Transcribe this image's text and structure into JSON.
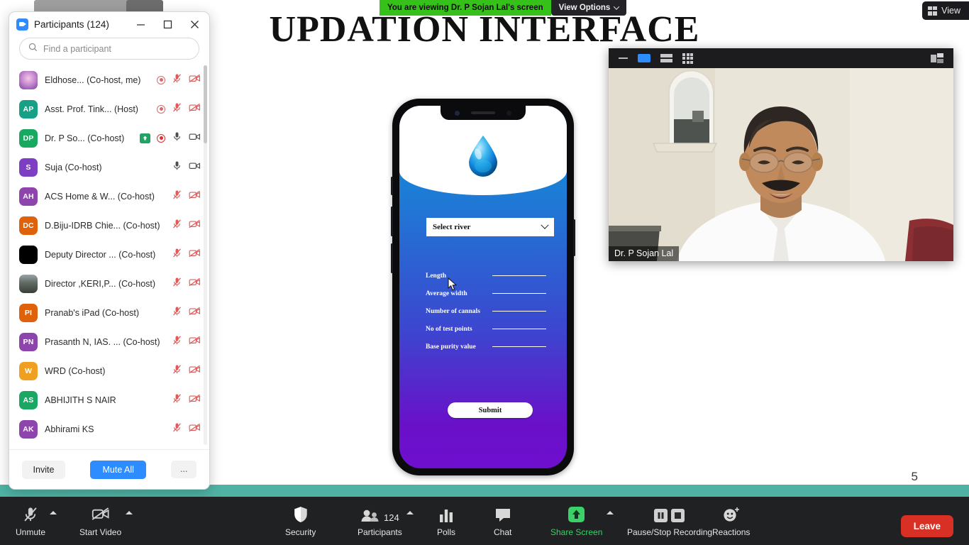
{
  "share_banner": {
    "viewing_text": "You are viewing Dr. P Sojan Lal's screen",
    "view_options_label": "View Options",
    "chevron_icon": "chevron-down-icon",
    "green": "#35c11a"
  },
  "view_pill": {
    "label": "View",
    "icon": "grid-view-icon"
  },
  "slide": {
    "title": "UPDATION INTERFACE",
    "page_number": "5",
    "phone": {
      "dropdown": {
        "label": "Select river",
        "chevron_icon": "chevron-down-icon"
      },
      "droplet_icon": "water-droplet-icon",
      "fields": [
        {
          "label": "Length"
        },
        {
          "label": "Average width"
        },
        {
          "label": "Number of cannals"
        },
        {
          "label": "No of test points"
        },
        {
          "label": "Base purity value"
        }
      ],
      "submit_label": "Submit"
    }
  },
  "participants_panel": {
    "title": "Participants",
    "count_label": "(124)",
    "app_icon": "zoom-logo-icon",
    "window_buttons": {
      "minimize": "minimize-icon",
      "maximize": "maximize-icon",
      "close": "close-icon"
    },
    "search": {
      "placeholder": "Find a participant",
      "icon": "search-icon"
    },
    "rows": [
      {
        "initials": "",
        "avatar": "photo1",
        "color": "#b77ac4",
        "name": "Eldhose... (Co-host, me)",
        "rec": "idle",
        "mic": "mic-muted-icon",
        "cam": "video-off-icon",
        "badge": ""
      },
      {
        "initials": "AP",
        "avatar": "letters",
        "color": "#16a085",
        "name": "Asst. Prof. Tink...  (Host)",
        "rec": "idle",
        "mic": "mic-muted-icon",
        "cam": "video-off-icon",
        "badge": ""
      },
      {
        "initials": "DP",
        "avatar": "letters",
        "color": "#18a860",
        "name": "Dr. P So... (Co-host)",
        "rec": "active",
        "mic": "mic-on-icon",
        "cam": "video-on-icon",
        "badge": "screen-share-icon"
      },
      {
        "initials": "S",
        "avatar": "letters",
        "color": "#7d3ec4",
        "name": "Suja (Co-host)",
        "rec": "none",
        "mic": "mic-on-icon",
        "cam": "video-on-icon",
        "badge": ""
      },
      {
        "initials": "AH",
        "avatar": "letters",
        "color": "#8e44ad",
        "name": "ACS Home & W...  (Co-host)",
        "rec": "none",
        "mic": "mic-muted-icon",
        "cam": "video-off-icon",
        "badge": ""
      },
      {
        "initials": "DC",
        "avatar": "letters",
        "color": "#e0610b",
        "name": "D.Biju-IDRB Chie... (Co-host)",
        "rec": "none",
        "mic": "mic-muted-icon",
        "cam": "video-off-icon",
        "badge": ""
      },
      {
        "initials": "",
        "avatar": "black",
        "color": "#000000",
        "name": "Deputy Director ... (Co-host)",
        "rec": "none",
        "mic": "mic-muted-icon",
        "cam": "video-off-icon",
        "badge": ""
      },
      {
        "initials": "",
        "avatar": "photo2",
        "color": "#5f6a63",
        "name": "Director ,KERI,P...  (Co-host)",
        "rec": "none",
        "mic": "mic-muted-icon",
        "cam": "video-off-icon",
        "badge": ""
      },
      {
        "initials": "PI",
        "avatar": "letters",
        "color": "#e0610b",
        "name": "Pranab's iPad (Co-host)",
        "rec": "none",
        "mic": "mic-muted-icon",
        "cam": "video-off-icon",
        "badge": ""
      },
      {
        "initials": "PN",
        "avatar": "letters",
        "color": "#8e44ad",
        "name": "Prasanth N, IAS. ... (Co-host)",
        "rec": "none",
        "mic": "mic-muted-icon",
        "cam": "video-off-icon",
        "badge": ""
      },
      {
        "initials": "W",
        "avatar": "letters",
        "color": "#f0a020",
        "name": "WRD (Co-host)",
        "rec": "none",
        "mic": "mic-muted-icon",
        "cam": "video-off-icon",
        "badge": ""
      },
      {
        "initials": "AS",
        "avatar": "letters",
        "color": "#1aa764",
        "name": "ABHIJITH S NAIR",
        "rec": "none",
        "mic": "mic-muted-icon",
        "cam": "video-off-icon",
        "badge": ""
      },
      {
        "initials": "AK",
        "avatar": "letters",
        "color": "#8e44ad",
        "name": "Abhirami KS",
        "rec": "none",
        "mic": "mic-muted-icon",
        "cam": "video-off-icon",
        "badge": ""
      }
    ],
    "footer": {
      "invite_label": "Invite",
      "mute_all_label": "Mute All",
      "more_label": "..."
    }
  },
  "video_window": {
    "name_label": "Dr. P Sojan Lal",
    "toolbar_icons": [
      "minimize-icon",
      "speaker-view-icon",
      "filmstrip-view-icon",
      "gallery-view-icon",
      "popout-icon"
    ]
  },
  "toolbar": {
    "items": [
      {
        "label": "Unmute",
        "icon": "mic-muted-icon",
        "caret": true,
        "accent": ""
      },
      {
        "label": "Start Video",
        "icon": "video-off-icon",
        "caret": true,
        "accent": ""
      },
      {
        "label": "Security",
        "icon": "shield-icon",
        "caret": false,
        "accent": ""
      },
      {
        "label": "Participants",
        "icon": "participants-icon",
        "caret": true,
        "accent": "",
        "count": "124"
      },
      {
        "label": "Polls",
        "icon": "polls-bar-chart-icon",
        "caret": false,
        "accent": ""
      },
      {
        "label": "Chat",
        "icon": "chat-bubble-icon",
        "caret": false,
        "accent": ""
      },
      {
        "label": "Share Screen",
        "icon": "share-screen-icon",
        "caret": true,
        "accent": "#3ad169"
      },
      {
        "label": "Pause/Stop Recording",
        "icon": "pause-stop-recording-icon",
        "caret": false,
        "accent": ""
      },
      {
        "label": "Reactions",
        "icon": "reactions-smiley-icon",
        "caret": false,
        "accent": ""
      }
    ],
    "leave_label": "Leave"
  }
}
